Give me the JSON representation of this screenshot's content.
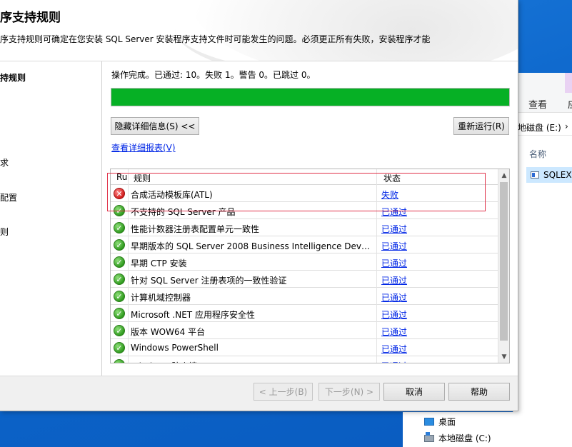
{
  "header": {
    "title": "序支持规则",
    "description": "序支持规则可确定在您安装 SQL Server 安装程序支持文件时可能发生的问题。必须更正所有失败，安装程序才能"
  },
  "leftnav": {
    "items": [
      {
        "label": "持规则",
        "active": true
      },
      {
        "label": "求",
        "active": false
      },
      {
        "label": "配置",
        "active": false
      },
      {
        "label": "则",
        "active": false
      }
    ]
  },
  "content": {
    "status_line": "操作完成。已通过: 10。失败 1。警告 0。已跳过 0。",
    "progress_percent": 100,
    "hide_details_label": "隐藏详细信息(S) <<",
    "rerun_label": "重新运行(R)",
    "view_report_label": "查看详细报表(V)"
  },
  "table": {
    "columns": [
      "Ru",
      "规则",
      "状态"
    ],
    "rows": [
      {
        "icon": "fail",
        "rule": "合成活动模板库(ATL)",
        "status": "失败"
      },
      {
        "icon": "ok",
        "rule": "不支持的 SQL Server 产品",
        "status": "已通过"
      },
      {
        "icon": "ok",
        "rule": "性能计数器注册表配置单元一致性",
        "status": "已通过"
      },
      {
        "icon": "ok",
        "rule": "早期版本的 SQL Server 2008 Business Intelligence Develo...",
        "status": "已通过"
      },
      {
        "icon": "ok",
        "rule": "早期 CTP 安装",
        "status": "已通过"
      },
      {
        "icon": "ok",
        "rule": "针对 SQL Server 注册表项的一致性验证",
        "status": "已通过"
      },
      {
        "icon": "ok",
        "rule": "计算机域控制器",
        "status": "已通过"
      },
      {
        "icon": "ok",
        "rule": "Microsoft .NET 应用程序安全性",
        "status": "已通过"
      },
      {
        "icon": "ok",
        "rule": "版本 WOW64 平台",
        "status": "已通过"
      },
      {
        "icon": "ok",
        "rule": "Windows PowerShell",
        "status": "已通过"
      },
      {
        "icon": "ok",
        "rule": "Windows 防火墙",
        "status": "已通过"
      }
    ]
  },
  "footer": {
    "prev_label": "< 上一步(B)",
    "next_label": "下一步(N) >",
    "cancel_label": "取消",
    "help_label": "帮助"
  },
  "explorer": {
    "tab_view": "查看",
    "tab_app": "应",
    "address": "地磁盘 (E:)",
    "column_name": "名称",
    "file_name": "SQLEX",
    "nav_desktop": "桌面",
    "nav_local_disk": "本地磁盘 (C:)"
  },
  "colors": {
    "progress_green": "#06b025",
    "link_blue": "#0026e6",
    "highlight_red": "#e0324a"
  }
}
